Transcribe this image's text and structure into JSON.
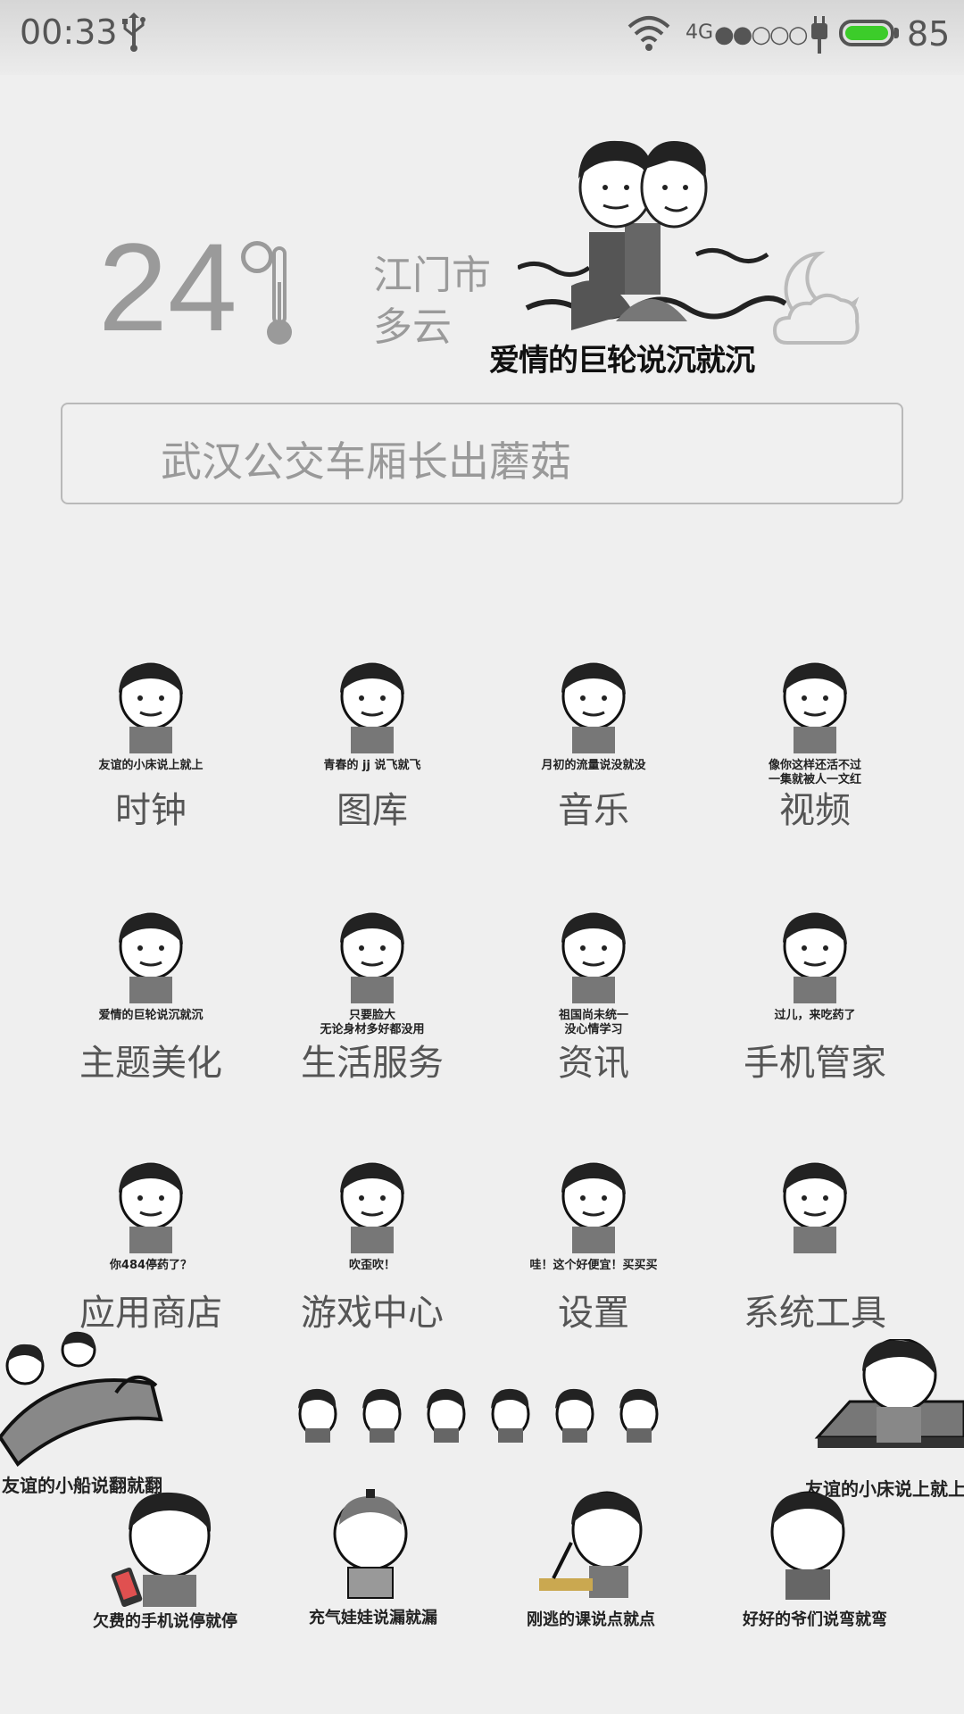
{
  "status_bar": {
    "time": "00:33",
    "network": "4G",
    "signal_dots": "●●○○○",
    "battery_level": "85",
    "battery_color": "#3ccc2a"
  },
  "weather": {
    "temperature": "24",
    "city": "江门市",
    "condition": "多云",
    "banner_caption": "爱情的巨轮说沉就沉"
  },
  "search": {
    "text": "武汉公交车厢长出蘑菇"
  },
  "apps": [
    {
      "label": "时钟",
      "caption": "友谊的小床说上就上"
    },
    {
      "label": "图库",
      "caption": "青春的 jj 说飞就飞"
    },
    {
      "label": "音乐",
      "caption": "月初的流量说没就没"
    },
    {
      "label": "视频",
      "caption": "像你这样还活不过\n一集就被人一文红"
    },
    {
      "label": "主题美化",
      "caption": "爱情的巨轮说沉就沉"
    },
    {
      "label": "生活服务",
      "caption": "只要脸大\n无论身材多好都没用"
    },
    {
      "label": "资讯",
      "caption": "祖国尚未统一\n没心情学习"
    },
    {
      "label": "手机管家",
      "caption": "过儿，来吃药了"
    },
    {
      "label": "应用商店",
      "caption": "你484停药了？"
    },
    {
      "label": "游戏中心",
      "caption": "吹歪吹！"
    },
    {
      "label": "设置",
      "caption": "哇！这个好便宜！买买买"
    },
    {
      "label": "系统工具",
      "caption": ""
    }
  ],
  "bottom_stickers": {
    "boat": "友谊的小船说翻就翻",
    "bed": "友谊的小床说上就上",
    "phone": "欠费的手机说停就停",
    "doll": "充气娃娃说漏就漏",
    "class": "刚逃的课说点就点",
    "bend": "好好的爷们说弯就弯"
  }
}
